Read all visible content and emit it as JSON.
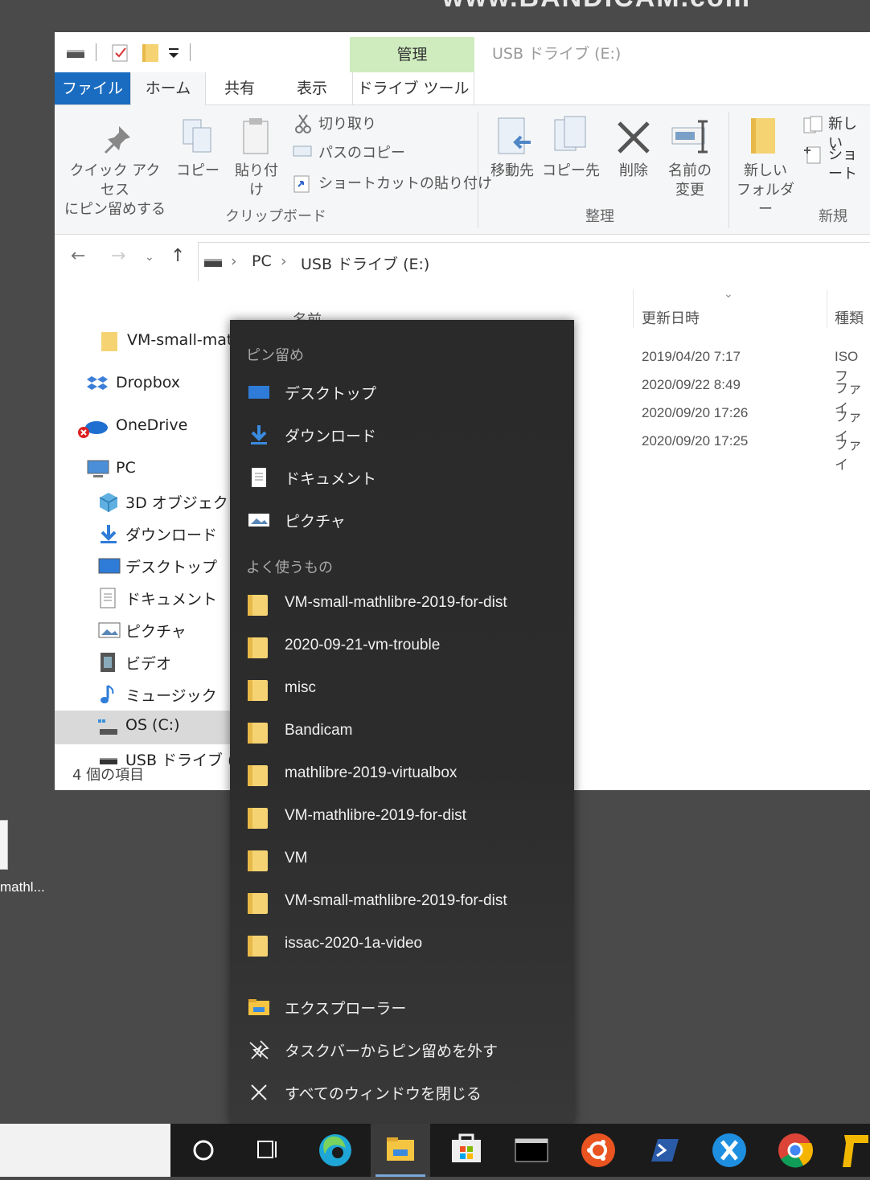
{
  "watermark": "www.BANDICAM.com",
  "desktop": {
    "icon_label": "mathl..."
  },
  "window": {
    "title": "USB ドライブ (E:)",
    "context_tab_group": "管理",
    "tabs": [
      "ファイル",
      "ホーム",
      "共有",
      "表示",
      "ドライブ ツール"
    ]
  },
  "ribbon": {
    "pin_quick_access": [
      "クイック アクセス",
      "にピン留めする"
    ],
    "copy": "コピー",
    "paste": "貼り付け",
    "cut": "切り取り",
    "copy_path": "パスのコピー",
    "paste_shortcut": "ショートカットの貼り付け",
    "group_clipboard": "クリップボード",
    "move_to": "移動先",
    "copy_to": "コピー先",
    "delete": "削除",
    "rename": [
      "名前の",
      "変更"
    ],
    "group_organize": "整理",
    "new_folder": [
      "新しい",
      "フォルダー"
    ],
    "new_item": "新しい",
    "shortcut": "ショート",
    "group_new": "新規"
  },
  "address": {
    "crumbs": [
      "PC",
      "USB ドライブ (E:)"
    ]
  },
  "nav_pane": {
    "items": [
      "VM-small-mathl",
      "Dropbox",
      "OneDrive",
      "PC",
      "3D オブジェクト",
      "ダウンロード",
      "デスクトップ",
      "ドキュメント",
      "ピクチャ",
      "ビデオ",
      "ミュージック",
      "OS (C:)",
      "USB ドライブ (E:)"
    ],
    "status": "4 個の項目"
  },
  "file_list": {
    "columns": [
      "名前",
      "更新日時",
      "種類"
    ],
    "rows": [
      {
        "date": "2019/04/20 7:17",
        "type": "ISO フ"
      },
      {
        "date": "2020/09/22 8:49",
        "type": "ファイ"
      },
      {
        "date": "2020/09/20 17:26",
        "type": "ファイ"
      },
      {
        "date": "2020/09/20 17:25",
        "type": "ファイ"
      }
    ]
  },
  "jumplist": {
    "pinned_header": "ピン留め",
    "pinned": [
      "デスクトップ",
      "ダウンロード",
      "ドキュメント",
      "ピクチャ"
    ],
    "frequent_header": "よく使うもの",
    "frequent": [
      "VM-small-mathlibre-2019-for-dist",
      "2020-09-21-vm-trouble",
      "misc",
      "Bandicam",
      "mathlibre-2019-virtualbox",
      "VM-mathlibre-2019-for-dist",
      "VM",
      "VM-small-mathlibre-2019-for-dist",
      "issac-2020-1a-video"
    ],
    "actions": [
      "エクスプローラー",
      "タスクバーからピン留めを外す",
      "すべてのウィンドウを閉じる"
    ]
  },
  "taskbar": {
    "apps": [
      "cortana-icon",
      "task-view-icon",
      "edge-icon",
      "file-explorer-icon",
      "store-icon",
      "terminal-icon",
      "ubuntu-icon",
      "powershell-icon",
      "xming-icon",
      "chrome-icon",
      "app-icon"
    ]
  },
  "colors": {
    "file_tab": "#1a6cc0",
    "context_tab": "#cfecbf",
    "jumplist_bg": "#2b2b2b",
    "taskbar_bg": "#1b1b1b",
    "folder": "#f5d372"
  }
}
